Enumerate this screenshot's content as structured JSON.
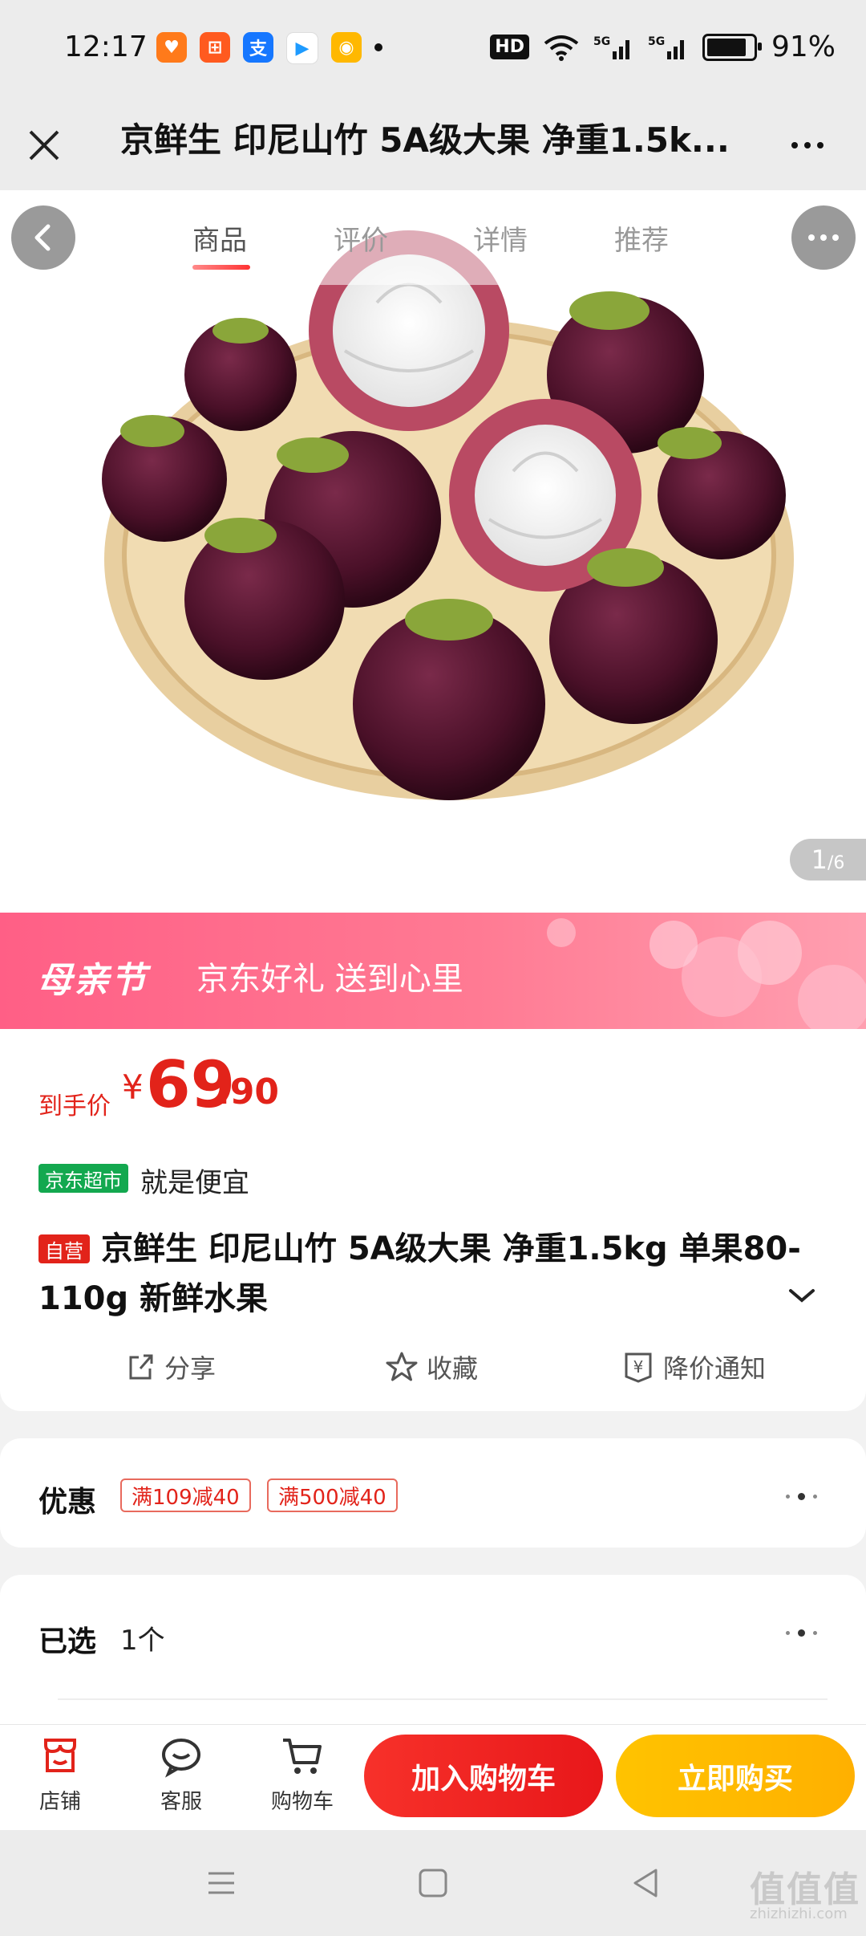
{
  "status_bar": {
    "time": "12:17",
    "network": "5G",
    "battery": "91%",
    "hd_badge": "HD",
    "app_icons": [
      {
        "name": "taobao-icon",
        "color": "#ff7a1a",
        "glyph": "♥"
      },
      {
        "name": "calendar-app-icon",
        "color": "#ff5a1f",
        "glyph": "⊞"
      },
      {
        "name": "alipay-icon",
        "color": "#1677ff",
        "glyph": "支"
      },
      {
        "name": "play-store-icon",
        "color": "#ffffff",
        "glyph": "▶"
      },
      {
        "name": "duck-app-icon",
        "color": "#ffb800",
        "glyph": "◉"
      }
    ]
  },
  "title_bar": {
    "title": "京鲜生 印尼山竹 5A级大果 净重1.5k..."
  },
  "tabs": [
    {
      "label": "商品",
      "active": true
    },
    {
      "label": "评价",
      "active": false
    },
    {
      "label": "详情",
      "active": false
    },
    {
      "label": "推荐",
      "active": false
    }
  ],
  "image_counter": {
    "current": "1",
    "total": "/6"
  },
  "banner": {
    "title": "母亲节",
    "subtitle": "京东好礼 送到心里",
    "color": "#ff6c8c"
  },
  "price": {
    "label": "到手价",
    "currency": "¥",
    "integer": "69",
    "decimal": ".90",
    "color": "#e2231a"
  },
  "store": {
    "badge": "京东超市",
    "slogan": "就是便宜"
  },
  "product": {
    "self_badge": "自营",
    "name": "京鲜生 印尼山竹 5A级大果 净重1.5kg 单果80-110g 新鲜水果"
  },
  "actions": [
    {
      "label": "分享",
      "icon": "share-icon"
    },
    {
      "label": "收藏",
      "icon": "star-icon"
    },
    {
      "label": "降价通知",
      "icon": "price-alert-icon"
    }
  ],
  "coupons": {
    "label": "优惠",
    "items": [
      "满109减40",
      "满500减40"
    ]
  },
  "selected": {
    "label": "已选",
    "value": "1个"
  },
  "bottom_bar": {
    "store": "店铺",
    "service": "客服",
    "cart": "购物车",
    "add_to_cart": "加入购物车",
    "buy_now": "立即购买"
  },
  "watermark": {
    "text": "值值值",
    "sub": "zhizhizhi.com"
  }
}
